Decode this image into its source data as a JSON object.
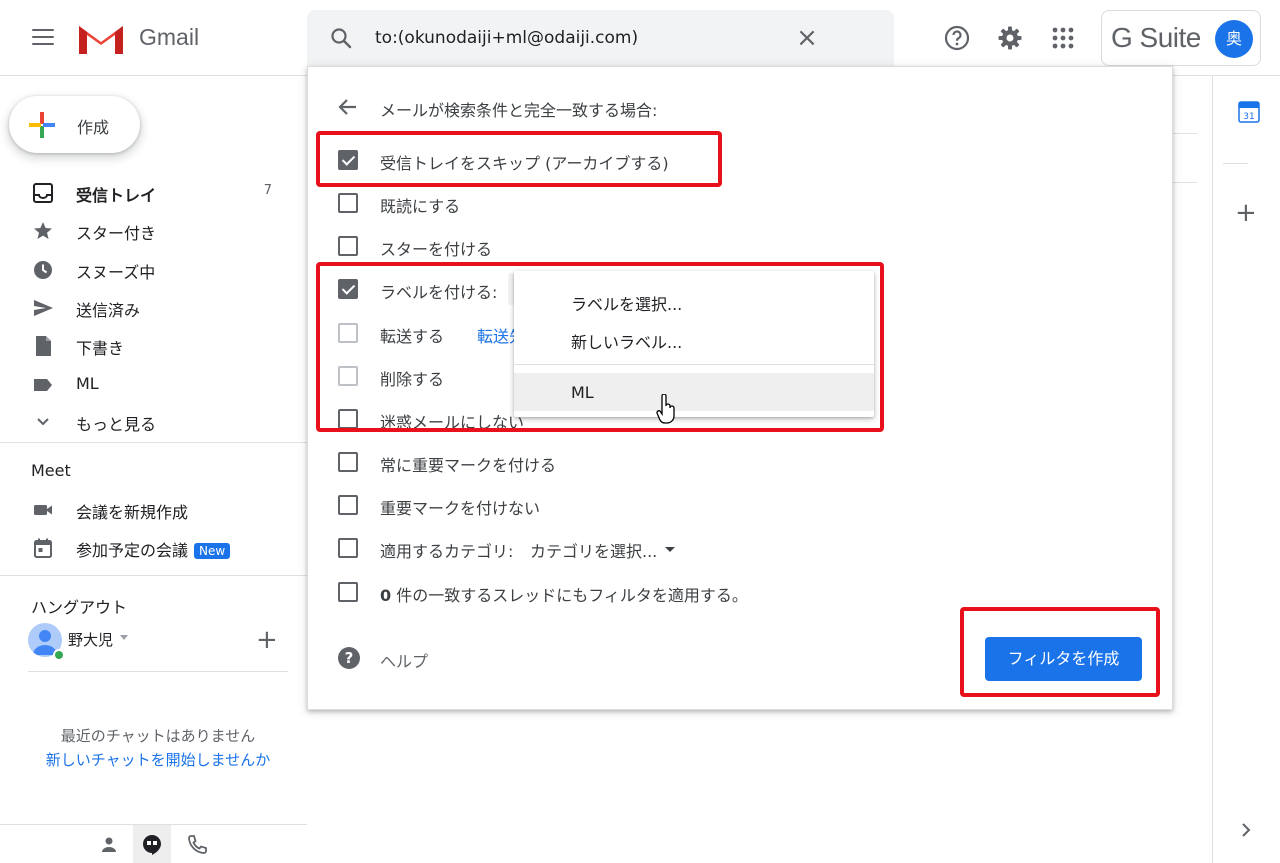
{
  "header": {
    "app_name": "Gmail",
    "search_value": "to:(okunodaiji+ml@odaiji.com)",
    "gsuite_text": "G Suite",
    "avatar_initial": "奥"
  },
  "sidebar": {
    "compose_label": "作成",
    "items": [
      {
        "label": "受信トレイ",
        "count": "7",
        "icon": "inbox-icon"
      },
      {
        "label": "スター付き",
        "icon": "star-icon"
      },
      {
        "label": "スヌーズ中",
        "icon": "clock-icon"
      },
      {
        "label": "送信済み",
        "icon": "send-icon"
      },
      {
        "label": "下書き",
        "icon": "draft-icon"
      },
      {
        "label": "ML",
        "icon": "label-icon"
      },
      {
        "label": "もっと見る",
        "icon": "chevron-down-icon"
      }
    ],
    "meet": {
      "title": "Meet",
      "new_meeting": "会議を新規作成",
      "scheduled": "参加予定の会議",
      "badge": "New"
    },
    "hangouts": {
      "title": "ハングアウト",
      "user_name": "野大児",
      "empty_text": "最近のチャットはありません",
      "start_link": "新しいチャットを開始しませんか"
    }
  },
  "filter_dialog": {
    "heading": "メールが検索条件と完全一致する場合:",
    "options": [
      {
        "label": "受信トレイをスキップ (アーカイブする)",
        "checked": true
      },
      {
        "label": "既読にする",
        "checked": false
      },
      {
        "label": "スターを付ける",
        "checked": false
      },
      {
        "label": "ラベルを付ける:",
        "checked": true
      },
      {
        "label": "転送する",
        "checked": false,
        "link": "転送先"
      },
      {
        "label": "削除する",
        "checked": false
      },
      {
        "label": "迷惑メールにしない",
        "checked": false
      },
      {
        "label": "常に重要マークを付ける",
        "checked": false
      },
      {
        "label": "重要マークを付けない",
        "checked": false
      },
      {
        "label": "適用するカテゴリ:",
        "checked": false,
        "select": "カテゴリを選択..."
      },
      {
        "label_count": "0",
        "label": " 件の一致するスレッドにもフィルタを適用する。",
        "checked": false
      }
    ],
    "help_label": "ヘルプ",
    "create_button": "フィルタを作成"
  },
  "label_dropdown": {
    "items": [
      "ラベルを選択...",
      "新しいラベル...",
      "ML"
    ],
    "hovered": "ML"
  },
  "colors": {
    "accent": "#1a73e8",
    "highlight": "#e8101a",
    "gmail_red": "#ea4335"
  }
}
